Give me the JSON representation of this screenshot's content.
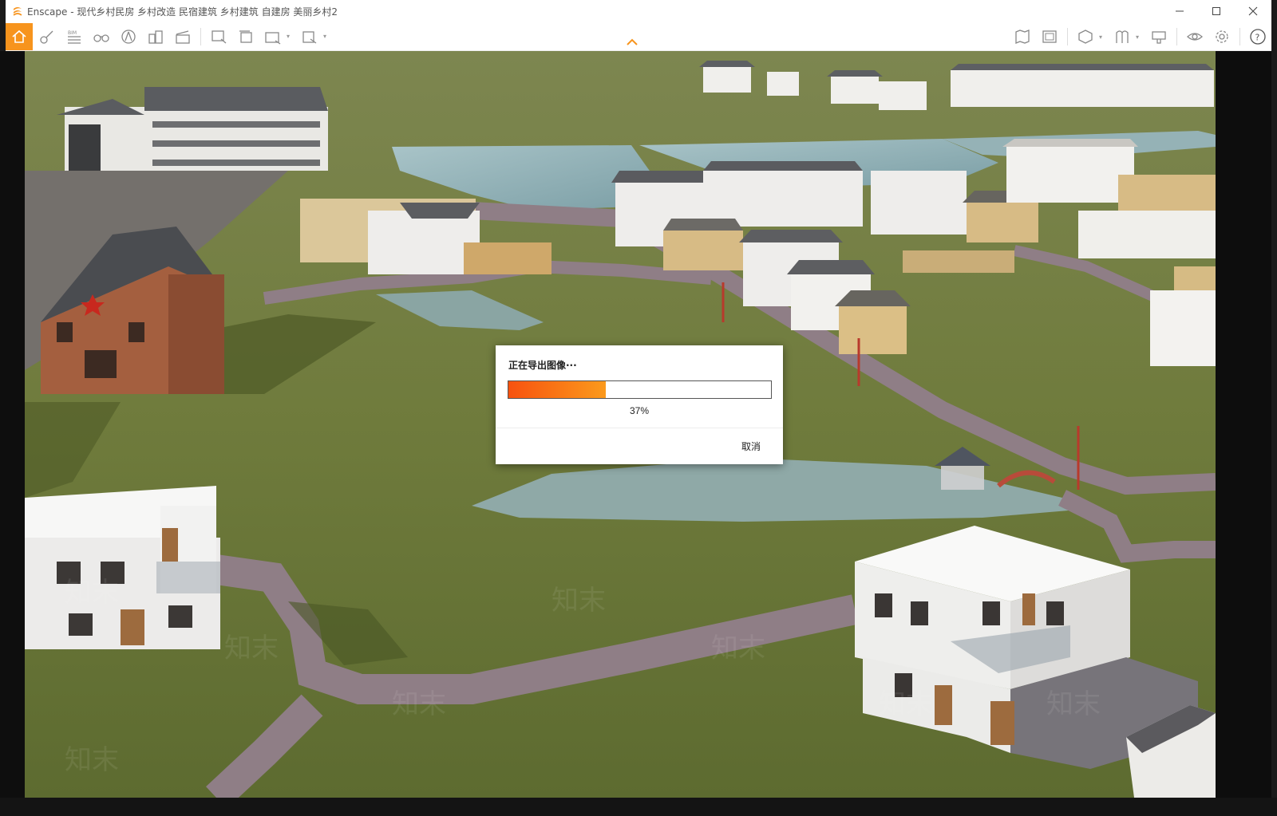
{
  "window": {
    "app_name": "Enscape",
    "title": "Enscape - 现代乡村民房 乡村改造 民宿建筑 乡村建筑 自建房 美丽乡村2",
    "controls": [
      "minimize-icon",
      "maximize-icon",
      "close-icon"
    ]
  },
  "toolbar": {
    "left_icons": [
      "home-icon",
      "visual-settings-icon",
      "bim-icon",
      "binoculars-icon",
      "asset-library-icon",
      "buildings-icon",
      "video-editor-icon",
      "screenshot-icon",
      "batch-render-icon",
      "panorama-360-icon",
      "export-exe-icon"
    ],
    "bim_label": "BIM",
    "right_icons": [
      "map-icon",
      "minimap-icon",
      "view-management-icon",
      "views-icon",
      "materials-icon",
      "visibility-icon",
      "settings-icon",
      "help-icon"
    ],
    "accent": "#f7941d"
  },
  "dialog": {
    "title": "正在导出图像···",
    "progress": 0.37,
    "progress_text": "37%",
    "cancel_label": "取消",
    "fill_colors": [
      "#f7520f",
      "#fb9a1c"
    ]
  }
}
